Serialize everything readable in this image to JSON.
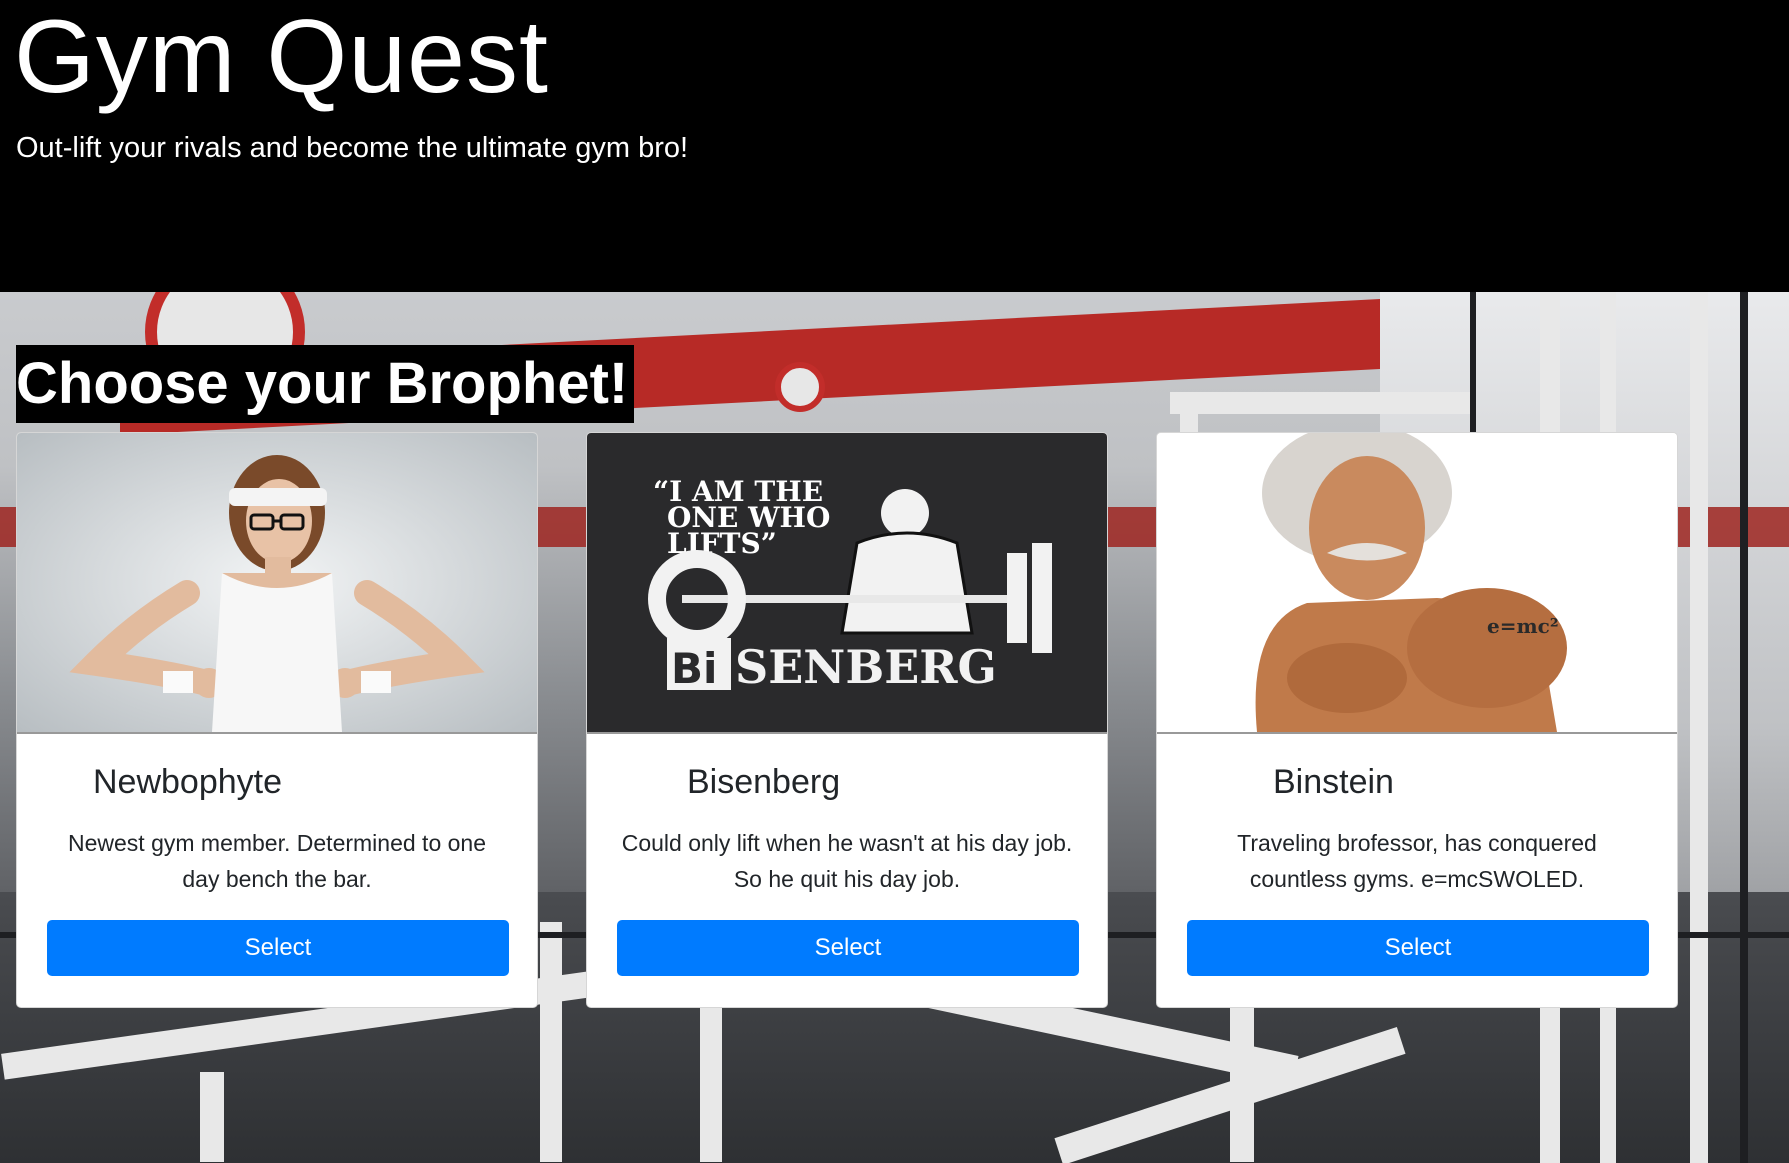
{
  "header": {
    "title": "Gym Quest",
    "subtitle": "Out-lift your rivals and become the ultimate gym bro!"
  },
  "main": {
    "heading": "Choose your Brophet!",
    "cards": [
      {
        "name": "Newbophyte",
        "description": "Newest gym member. Determined to one day bench the bar.",
        "button_label": "Select",
        "image": "skinny-nerd-flexing-photo"
      },
      {
        "name": "Bisenberg",
        "description": "Could only lift when he wasn't at his day job. So he quit his day job.",
        "button_label": "Select",
        "image": "bisenberg-poster",
        "image_text": {
          "quote": "“I AM THE ONE WHO LIFTS”",
          "logo_prefix": "Bi",
          "logo_rest": "SENBERG"
        }
      },
      {
        "name": "Binstein",
        "description": "Traveling brofessor, has conquered countless gyms. e=mcSWOLED.",
        "button_label": "Select",
        "image": "muscular-einstein-photo",
        "image_text": {
          "tattoo": "e=mc²"
        }
      }
    ]
  },
  "colors": {
    "header_bg": "#000000",
    "button_bg": "#007bff",
    "card_bg": "#ffffff"
  }
}
